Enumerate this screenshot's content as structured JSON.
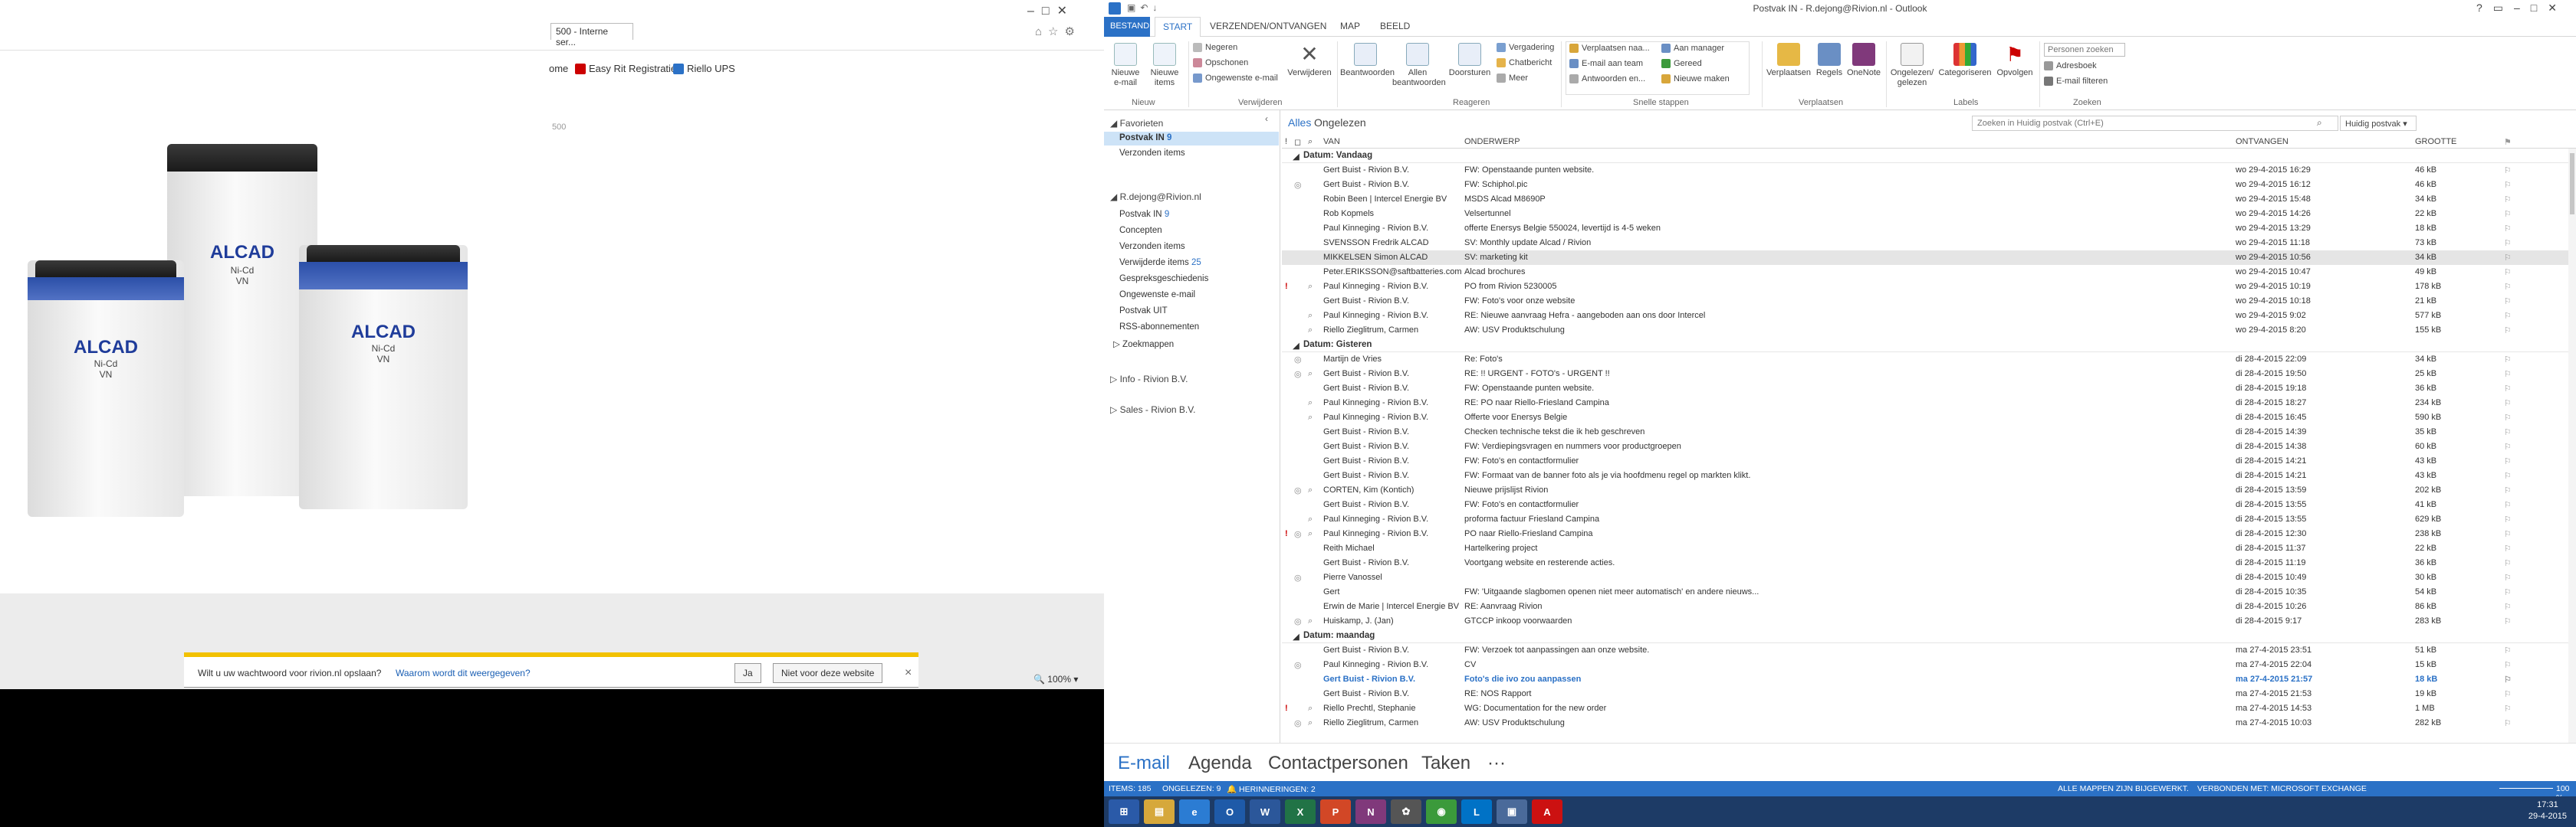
{
  "ie": {
    "tab_title": "500 - Interne ser...",
    "favorites": [
      {
        "label": "ome"
      },
      {
        "label": "Easy Rit Registratie"
      },
      {
        "label": "Riello UPS"
      }
    ],
    "page_hint": "500",
    "battery_brand": "ALCAD",
    "battery_type": "Ni-Cd",
    "battery_sub": "VN",
    "password_prompt": {
      "text": "Wilt u uw wachtwoord voor rivion.nl opslaan?",
      "link": "Waarom wordt dit weergegeven?",
      "yes": "Ja",
      "no": "Niet voor deze website",
      "close": "×"
    },
    "zoom": "100%"
  },
  "outlook": {
    "title": "Postvak IN - R.dejong@Rivion.nl - Outlook",
    "tabs": [
      "BESTAND",
      "START",
      "VERZENDEN/ONTVANGEN",
      "MAP",
      "BEELD"
    ],
    "ribbon": {
      "nieuw": {
        "label": "Nieuw",
        "new_email": "Nieuwe e-mail",
        "new_items": "Nieuwe items"
      },
      "verwijderen": {
        "label": "Verwijderen",
        "ignore": "Negeren",
        "cleanup": "Opschonen",
        "junk": "Ongewenste e-mail",
        "delete": "Verwijderen"
      },
      "reageren": {
        "label": "Reageren",
        "reply": "Beantwoorden",
        "reply_all": "Allen beantwoorden",
        "forward": "Doorsturen",
        "meeting": "Vergadering",
        "chat": "Chatbericht",
        "more": "Meer"
      },
      "snelle_stappen": {
        "label": "Snelle stappen",
        "items": [
          "Verplaatsen naa...",
          "E-mail aan team",
          "Antwoorden en...",
          "Aan manager",
          "Gereed",
          "Nieuwe maken"
        ]
      },
      "verplaatsen": {
        "label": "Verplaatsen",
        "move": "Verplaatsen",
        "rules": "Regels",
        "onenote": "OneNote"
      },
      "labels": {
        "label": "Labels",
        "unread": "Ongelezen/ gelezen",
        "categorize": "Categoriseren",
        "followup": "Opvolgen"
      },
      "zoeken": {
        "label": "Zoeken",
        "people_placeholder": "Personen zoeken",
        "address_book": "Adresboek",
        "filter": "E-mail filteren"
      }
    },
    "nav": {
      "favorites_header": "Favorieten",
      "favorites": [
        {
          "label": "Postvak IN",
          "count": "9"
        },
        {
          "label": "Verzonden items",
          "count": ""
        }
      ],
      "account": "R.dejong@Rivion.nl",
      "folders": [
        {
          "label": "Postvak IN",
          "count": "9"
        },
        {
          "label": "Concepten",
          "count": ""
        },
        {
          "label": "Verzonden items",
          "count": ""
        },
        {
          "label": "Verwijderde items",
          "count": "25"
        },
        {
          "label": "Gespreksgeschiedenis",
          "count": ""
        },
        {
          "label": "Ongewenste e-mail",
          "count": ""
        },
        {
          "label": "Postvak UIT",
          "count": ""
        },
        {
          "label": "RSS-abonnementen",
          "count": ""
        },
        {
          "label": "Zoekmappen",
          "count": ""
        }
      ],
      "other_accounts": [
        "Info - Rivion B.V.",
        "Sales - Rivion B.V."
      ]
    },
    "filters": {
      "all": "Alles",
      "unread": "Ongelezen"
    },
    "search_placeholder": "Zoeken in Huidig postvak (Ctrl+E)",
    "search_scope": "Huidig postvak",
    "columns": {
      "from": "VAN",
      "subject": "ONDERWERP",
      "received": "ONTVANGEN",
      "size": "GROOTTE"
    },
    "groups": [
      {
        "label": "Datum: Vandaag",
        "rows": [
          {
            "from": "Gert Buist - Rivion B.V.",
            "subject": "FW: Openstaande punten website.",
            "date": "wo 29-4-2015 16:29",
            "size": "46 kB",
            "imp": "",
            "ico": "",
            "att": ""
          },
          {
            "from": "Gert Buist - Rivion B.V.",
            "subject": "FW: Schiphol.pic",
            "date": "wo 29-4-2015 16:12",
            "size": "46 kB",
            "imp": "",
            "ico": "◎",
            "att": ""
          },
          {
            "from": "Robin Been | Intercel Energie BV",
            "subject": "MSDS Alcad M8690P",
            "date": "wo 29-4-2015 15:48",
            "size": "34 kB",
            "imp": "",
            "ico": "",
            "att": ""
          },
          {
            "from": "Rob Kopmels",
            "subject": "Velsertunnel",
            "date": "wo 29-4-2015 14:26",
            "size": "22 kB",
            "imp": "",
            "ico": "",
            "att": ""
          },
          {
            "from": "Paul Kinneging - Rivion B.V.",
            "subject": "offerte Enersys Belgie 550024, levertijd is 4-5 weken",
            "date": "wo 29-4-2015 13:29",
            "size": "18 kB",
            "imp": "",
            "ico": "",
            "att": ""
          },
          {
            "from": "SVENSSON Fredrik ALCAD",
            "subject": "SV: Monthly update Alcad / Rivion",
            "date": "wo 29-4-2015 11:18",
            "size": "73 kB",
            "imp": "",
            "ico": "",
            "att": ""
          },
          {
            "from": "MIKKELSEN Simon ALCAD",
            "subject": "SV: marketing kit",
            "date": "wo 29-4-2015 10:56",
            "size": "34 kB",
            "imp": "",
            "ico": "",
            "att": "",
            "sel": true
          },
          {
            "from": "Peter.ERIKSSON@saftbatteries.com",
            "subject": "Alcad brochures",
            "date": "wo 29-4-2015 10:47",
            "size": "49 kB",
            "imp": "",
            "ico": "",
            "att": ""
          },
          {
            "from": "Paul Kinneging - Rivion B.V.",
            "subject": "PO from Rivion 5230005",
            "date": "wo 29-4-2015 10:19",
            "size": "178 kB",
            "imp": "!",
            "ico": "",
            "att": "⌕"
          },
          {
            "from": "Gert Buist - Rivion B.V.",
            "subject": "FW: Foto's voor onze website",
            "date": "wo 29-4-2015 10:18",
            "size": "21 kB",
            "imp": "",
            "ico": "",
            "att": ""
          },
          {
            "from": "Paul Kinneging - Rivion B.V.",
            "subject": "RE: Nieuwe aanvraag Hefra - aangeboden aan ons door Intercel",
            "date": "wo 29-4-2015 9:02",
            "size": "577 kB",
            "imp": "",
            "ico": "",
            "att": "⌕"
          },
          {
            "from": "Riello Zieglitrum, Carmen",
            "subject": "AW: USV Produktschulung",
            "date": "wo 29-4-2015 8:20",
            "size": "155 kB",
            "imp": "",
            "ico": "",
            "att": "⌕"
          }
        ]
      },
      {
        "label": "Datum: Gisteren",
        "rows": [
          {
            "from": "Martijn de Vries",
            "subject": "Re: Foto's",
            "date": "di 28-4-2015 22:09",
            "size": "34 kB",
            "imp": "",
            "ico": "◎",
            "att": ""
          },
          {
            "from": "Gert Buist - Rivion B.V.",
            "subject": "RE: !! URGENT - FOTO's - URGENT !!",
            "date": "di 28-4-2015 19:50",
            "size": "25 kB",
            "imp": "",
            "ico": "◎",
            "att": "⌕"
          },
          {
            "from": "Gert Buist - Rivion B.V.",
            "subject": "FW: Openstaande punten website.",
            "date": "di 28-4-2015 19:18",
            "size": "36 kB",
            "imp": "",
            "ico": "",
            "att": ""
          },
          {
            "from": "Paul Kinneging - Rivion B.V.",
            "subject": "RE: PO naar Riello-Friesland Campina",
            "date": "di 28-4-2015 18:27",
            "size": "234 kB",
            "imp": "",
            "ico": "",
            "att": "⌕"
          },
          {
            "from": "Paul Kinneging - Rivion B.V.",
            "subject": "Offerte voor Enersys Belgie",
            "date": "di 28-4-2015 16:45",
            "size": "590 kB",
            "imp": "",
            "ico": "",
            "att": "⌕"
          },
          {
            "from": "Gert Buist - Rivion B.V.",
            "subject": "Checken technische tekst die ik heb geschreven",
            "date": "di 28-4-2015 14:39",
            "size": "35 kB",
            "imp": "",
            "ico": "",
            "att": ""
          },
          {
            "from": "Gert Buist - Rivion B.V.",
            "subject": "FW: Verdiepingsvragen en nummers voor productgroepen",
            "date": "di 28-4-2015 14:38",
            "size": "60 kB",
            "imp": "",
            "ico": "",
            "att": ""
          },
          {
            "from": "Gert Buist - Rivion B.V.",
            "subject": "FW: Foto's en contactformulier",
            "date": "di 28-4-2015 14:21",
            "size": "43 kB",
            "imp": "",
            "ico": "",
            "att": ""
          },
          {
            "from": "Gert Buist - Rivion B.V.",
            "subject": "FW: Formaat van de banner foto als je via hoofdmenu regel op markten klikt.",
            "date": "di 28-4-2015 14:21",
            "size": "43 kB",
            "imp": "",
            "ico": "",
            "att": ""
          },
          {
            "from": "CORTEN, Kim (Kontich)",
            "subject": "Nieuwe prijslijst Rivion",
            "date": "di 28-4-2015 13:59",
            "size": "202 kB",
            "imp": "",
            "ico": "◎",
            "att": "⌕"
          },
          {
            "from": "Gert Buist - Rivion B.V.",
            "subject": "FW: Foto's en contactformulier",
            "date": "di 28-4-2015 13:55",
            "size": "41 kB",
            "imp": "",
            "ico": "",
            "att": ""
          },
          {
            "from": "Paul Kinneging - Rivion B.V.",
            "subject": "proforma factuur Friesland Campina",
            "date": "di 28-4-2015 13:55",
            "size": "629 kB",
            "imp": "",
            "ico": "",
            "att": "⌕"
          },
          {
            "from": "Paul Kinneging - Rivion B.V.",
            "subject": "PO naar Riello-Friesland Campina",
            "date": "di 28-4-2015 12:30",
            "size": "238 kB",
            "imp": "!",
            "ico": "◎",
            "att": "⌕"
          },
          {
            "from": "Reith Michael",
            "subject": "Hartelkering project",
            "date": "di 28-4-2015 11:37",
            "size": "22 kB",
            "imp": "",
            "ico": "",
            "att": ""
          },
          {
            "from": "Gert Buist - Rivion B.V.",
            "subject": "Voortgang website en resterende acties.",
            "date": "di 28-4-2015 11:19",
            "size": "36 kB",
            "imp": "",
            "ico": "",
            "att": ""
          },
          {
            "from": "Pierre Vanossel",
            "subject": "",
            "date": "di 28-4-2015 10:49",
            "size": "30 kB",
            "imp": "",
            "ico": "◎",
            "att": ""
          },
          {
            "from": "Gert",
            "subject": "FW: 'Uitgaande slagbomen openen niet meer automatisch' en andere nieuws...",
            "date": "di 28-4-2015 10:35",
            "size": "54 kB",
            "imp": "",
            "ico": "",
            "att": ""
          },
          {
            "from": "Erwin de Marie | Intercel Energie BV",
            "subject": "RE: Aanvraag Rivion",
            "date": "di 28-4-2015 10:26",
            "size": "86 kB",
            "imp": "",
            "ico": "",
            "att": ""
          },
          {
            "from": "Huiskamp, J. (Jan)",
            "subject": "GTCCP inkoop voorwaarden",
            "date": "di 28-4-2015 9:17",
            "size": "283 kB",
            "imp": "",
            "ico": "◎",
            "att": "⌕"
          }
        ]
      },
      {
        "label": "Datum: maandag",
        "rows": [
          {
            "from": "Gert Buist - Rivion B.V.",
            "subject": "FW: Verzoek tot aanpassingen aan onze website.",
            "date": "ma 27-4-2015 23:51",
            "size": "51 kB",
            "imp": "",
            "ico": "",
            "att": ""
          },
          {
            "from": "Paul Kinneging - Rivion B.V.",
            "subject": "CV",
            "date": "ma 27-4-2015 22:04",
            "size": "15 kB",
            "imp": "",
            "ico": "◎",
            "att": ""
          },
          {
            "from": "Gert Buist - Rivion B.V.",
            "subject": "Foto's die ivo zou aanpassen",
            "date": "ma 27-4-2015 21:57",
            "size": "18 kB",
            "imp": "",
            "ico": "",
            "att": "",
            "unread": true
          },
          {
            "from": "Gert Buist - Rivion B.V.",
            "subject": "RE: NOS Rapport",
            "date": "ma 27-4-2015 21:53",
            "size": "19 kB",
            "imp": "",
            "ico": "",
            "att": ""
          },
          {
            "from": "Riello Prechtl, Stephanie",
            "subject": "WG: Documentation for the new order",
            "date": "ma 27-4-2015 14:53",
            "size": "1 MB",
            "imp": "!",
            "ico": "",
            "att": "⌕"
          },
          {
            "from": "Riello Zieglitrum, Carmen",
            "subject": "AW: USV Produktschulung",
            "date": "ma 27-4-2015 10:03",
            "size": "282 kB",
            "imp": "",
            "ico": "◎",
            "att": "⌕"
          }
        ]
      }
    ],
    "bottom_nav": [
      "E-mail",
      "Agenda",
      "Contactpersonen",
      "Taken",
      "···"
    ],
    "status": {
      "items": "ITEMS: 185",
      "unread": "ONGELEZEN: 9",
      "reminders": "HERINNERINGEN: 2",
      "folders_updated": "ALLE MAPPEN ZIJN BIJGEWERKT.",
      "connected": "VERBONDEN MET: MICROSOFT EXCHANGE",
      "zoom": "100 %"
    },
    "clock": {
      "time": "17:31",
      "date": "29-4-2015"
    }
  },
  "taskbar": {
    "apps": [
      {
        "name": "start",
        "glyph": "⊞",
        "color": "#2a5aa8"
      },
      {
        "name": "explorer",
        "glyph": "▤",
        "color": "#d6a83b"
      },
      {
        "name": "ie",
        "glyph": "e",
        "color": "#2b7cd3"
      },
      {
        "name": "outlook",
        "glyph": "O",
        "color": "#1e5aa8"
      },
      {
        "name": "word",
        "glyph": "W",
        "color": "#2b579a"
      },
      {
        "name": "excel",
        "glyph": "X",
        "color": "#217346"
      },
      {
        "name": "powerpoint",
        "glyph": "P",
        "color": "#d24726"
      },
      {
        "name": "onenote",
        "glyph": "N",
        "color": "#80397b"
      },
      {
        "name": "tool",
        "glyph": "✿",
        "color": "#555"
      },
      {
        "name": "chrome",
        "glyph": "◉",
        "color": "#3b9a3b"
      },
      {
        "name": "lync",
        "glyph": "L",
        "color": "#0072c6"
      },
      {
        "name": "remote",
        "glyph": "▣",
        "color": "#4a6a9a"
      },
      {
        "name": "acrobat",
        "glyph": "A",
        "color": "#c11"
      }
    ]
  }
}
